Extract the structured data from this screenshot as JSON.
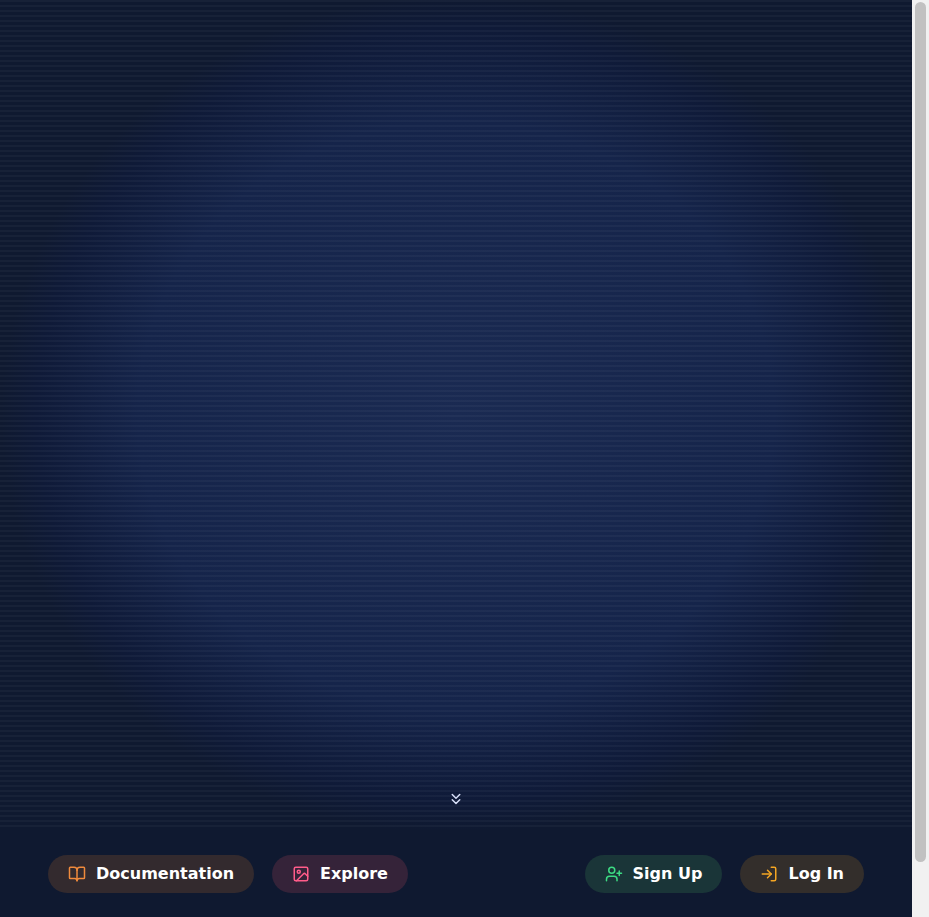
{
  "nav": {
    "left": [
      {
        "label": "Documentation",
        "color": "#f08a3c"
      },
      {
        "label": "Explore",
        "color": "#ff5c8a"
      }
    ],
    "right": [
      {
        "label": "Sign Up",
        "color": "#3ddc84"
      },
      {
        "label": "Log In",
        "color": "#f5a623"
      }
    ]
  }
}
